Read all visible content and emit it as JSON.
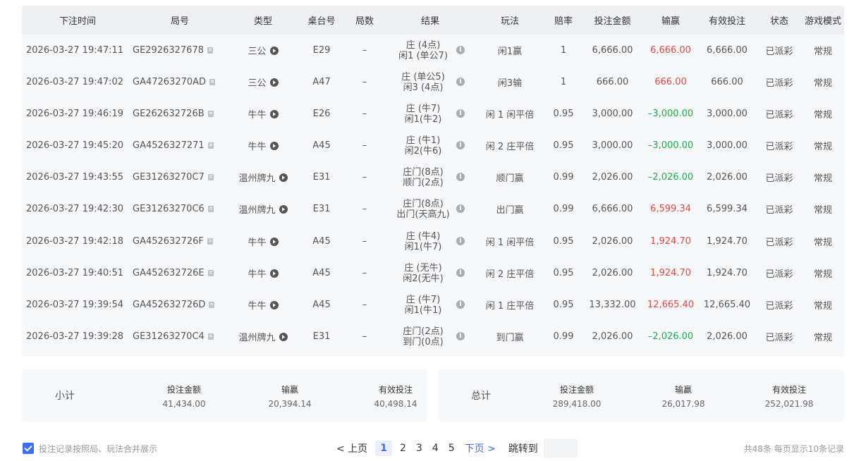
{
  "table": {
    "headers": [
      "下注时间",
      "局号",
      "类型",
      "桌台号",
      "局数",
      "结果",
      "玩法",
      "赔率",
      "投注金额",
      "输赢",
      "有效投注",
      "状态",
      "游戏模式"
    ],
    "rows": [
      {
        "time": "2026-03-27 19:47:11",
        "round": "GE2926327678",
        "type": "三公",
        "table": "E29",
        "count": "–",
        "result1": "庄 (4点)",
        "result2": "闲1 (单公7)",
        "play": "闲1赢",
        "odds": "1",
        "bet": "6,666.00",
        "win": "6,666.00",
        "win_color": "red",
        "valid": "6,666.00",
        "status": "已派彩",
        "mode": "常规"
      },
      {
        "time": "2026-03-27 19:47:02",
        "round": "GA47263270AD",
        "type": "三公",
        "table": "A47",
        "count": "–",
        "result1": "庄 (单公5)",
        "result2": "闲3 (4点)",
        "play": "闲3输",
        "odds": "1",
        "bet": "666.00",
        "win": "666.00",
        "win_color": "red",
        "valid": "666.00",
        "status": "已派彩",
        "mode": "常规"
      },
      {
        "time": "2026-03-27 19:46:19",
        "round": "GE262632726B",
        "type": "牛牛",
        "table": "E26",
        "count": "–",
        "result1": "庄 (牛7)",
        "result2": "闲1(牛2)",
        "play": "闲 1 闲平倍",
        "odds": "0.95",
        "bet": "3,000.00",
        "win": "–3,000.00",
        "win_color": "green",
        "valid": "3,000.00",
        "status": "已派彩",
        "mode": "常规"
      },
      {
        "time": "2026-03-27 19:45:20",
        "round": "GA4526327271",
        "type": "牛牛",
        "table": "A45",
        "count": "–",
        "result1": "庄 (牛1)",
        "result2": "闲2(牛6)",
        "play": "闲 2 庄平倍",
        "odds": "0.95",
        "bet": "3,000.00",
        "win": "–3,000.00",
        "win_color": "green",
        "valid": "3,000.00",
        "status": "已派彩",
        "mode": "常规"
      },
      {
        "time": "2026-03-27 19:43:55",
        "round": "GE31263270C7",
        "type": "温州牌九",
        "table": "E31",
        "count": "–",
        "result1": "庄门(8点)",
        "result2": "顺门(2点)",
        "play": "顺门赢",
        "odds": "0.99",
        "bet": "2,026.00",
        "win": "–2,026.00",
        "win_color": "green",
        "valid": "2,026.00",
        "status": "已派彩",
        "mode": "常规"
      },
      {
        "time": "2026-03-27 19:42:30",
        "round": "GE31263270C6",
        "type": "温州牌九",
        "table": "E31",
        "count": "–",
        "result1": "庄门(8点)",
        "result2": "出门(天高九)",
        "play": "出门赢",
        "odds": "0.99",
        "bet": "6,666.00",
        "win": "6,599.34",
        "win_color": "red",
        "valid": "6,599.34",
        "status": "已派彩",
        "mode": "常规"
      },
      {
        "time": "2026-03-27 19:42:18",
        "round": "GA452632726F",
        "type": "牛牛",
        "table": "A45",
        "count": "–",
        "result1": "庄 (牛4)",
        "result2": "闲1(牛7)",
        "play": "闲 1 闲平倍",
        "odds": "0.95",
        "bet": "2,026.00",
        "win": "1,924.70",
        "win_color": "red",
        "valid": "1,924.70",
        "status": "已派彩",
        "mode": "常规"
      },
      {
        "time": "2026-03-27 19:40:51",
        "round": "GA452632726E",
        "type": "牛牛",
        "table": "A45",
        "count": "–",
        "result1": "庄 (无牛)",
        "result2": "闲2(无牛)",
        "play": "闲 2 庄平倍",
        "odds": "0.95",
        "bet": "2,026.00",
        "win": "1,924.70",
        "win_color": "red",
        "valid": "1,924.70",
        "status": "已派彩",
        "mode": "常规"
      },
      {
        "time": "2026-03-27 19:39:54",
        "round": "GA452632726D",
        "type": "牛牛",
        "table": "A45",
        "count": "–",
        "result1": "庄 (牛7)",
        "result2": "闲1(牛1)",
        "play": "闲 1 庄平倍",
        "odds": "0.95",
        "bet": "13,332.00",
        "win": "12,665.40",
        "win_color": "red",
        "valid": "12,665.40",
        "status": "已派彩",
        "mode": "常规"
      },
      {
        "time": "2026-03-27 19:39:28",
        "round": "GE31263270C4",
        "type": "温州牌九",
        "table": "E31",
        "count": "–",
        "result1": "庄门(2点)",
        "result2": "到门(0点)",
        "play": "到门赢",
        "odds": "0.99",
        "bet": "2,026.00",
        "win": "–2,026.00",
        "win_color": "green",
        "valid": "2,026.00",
        "status": "已派彩",
        "mode": "常规"
      }
    ]
  },
  "subtotal": {
    "title": "小计",
    "bet_label": "投注金额",
    "bet_value": "41,434.00",
    "win_label": "输赢",
    "win_value": "20,394.14",
    "valid_label": "有效投注",
    "valid_value": "40,498.14"
  },
  "total": {
    "title": "总计",
    "bet_label": "投注金额",
    "bet_value": "289,418.00",
    "win_label": "输赢",
    "win_value": "26,017.98",
    "valid_label": "有效投注",
    "valid_value": "252,021.98"
  },
  "footer": {
    "merge_label": "投注记录按照局、玩法合并展示",
    "merge_checked": true,
    "prev_label": "< 上页",
    "pages": [
      "1",
      "2",
      "3",
      "4",
      "5"
    ],
    "current_page": "1",
    "next_label": "下页 >",
    "jump_label": "跳转到",
    "page_info": "共48条  每页显示10条记录"
  },
  "colors": {
    "accent": "#3b6ff0",
    "win_red": "#e8473f",
    "loss_green": "#17b04a"
  },
  "icons": [
    "copy-icon",
    "play-icon",
    "info-icon",
    "checkbox-check-icon"
  ]
}
